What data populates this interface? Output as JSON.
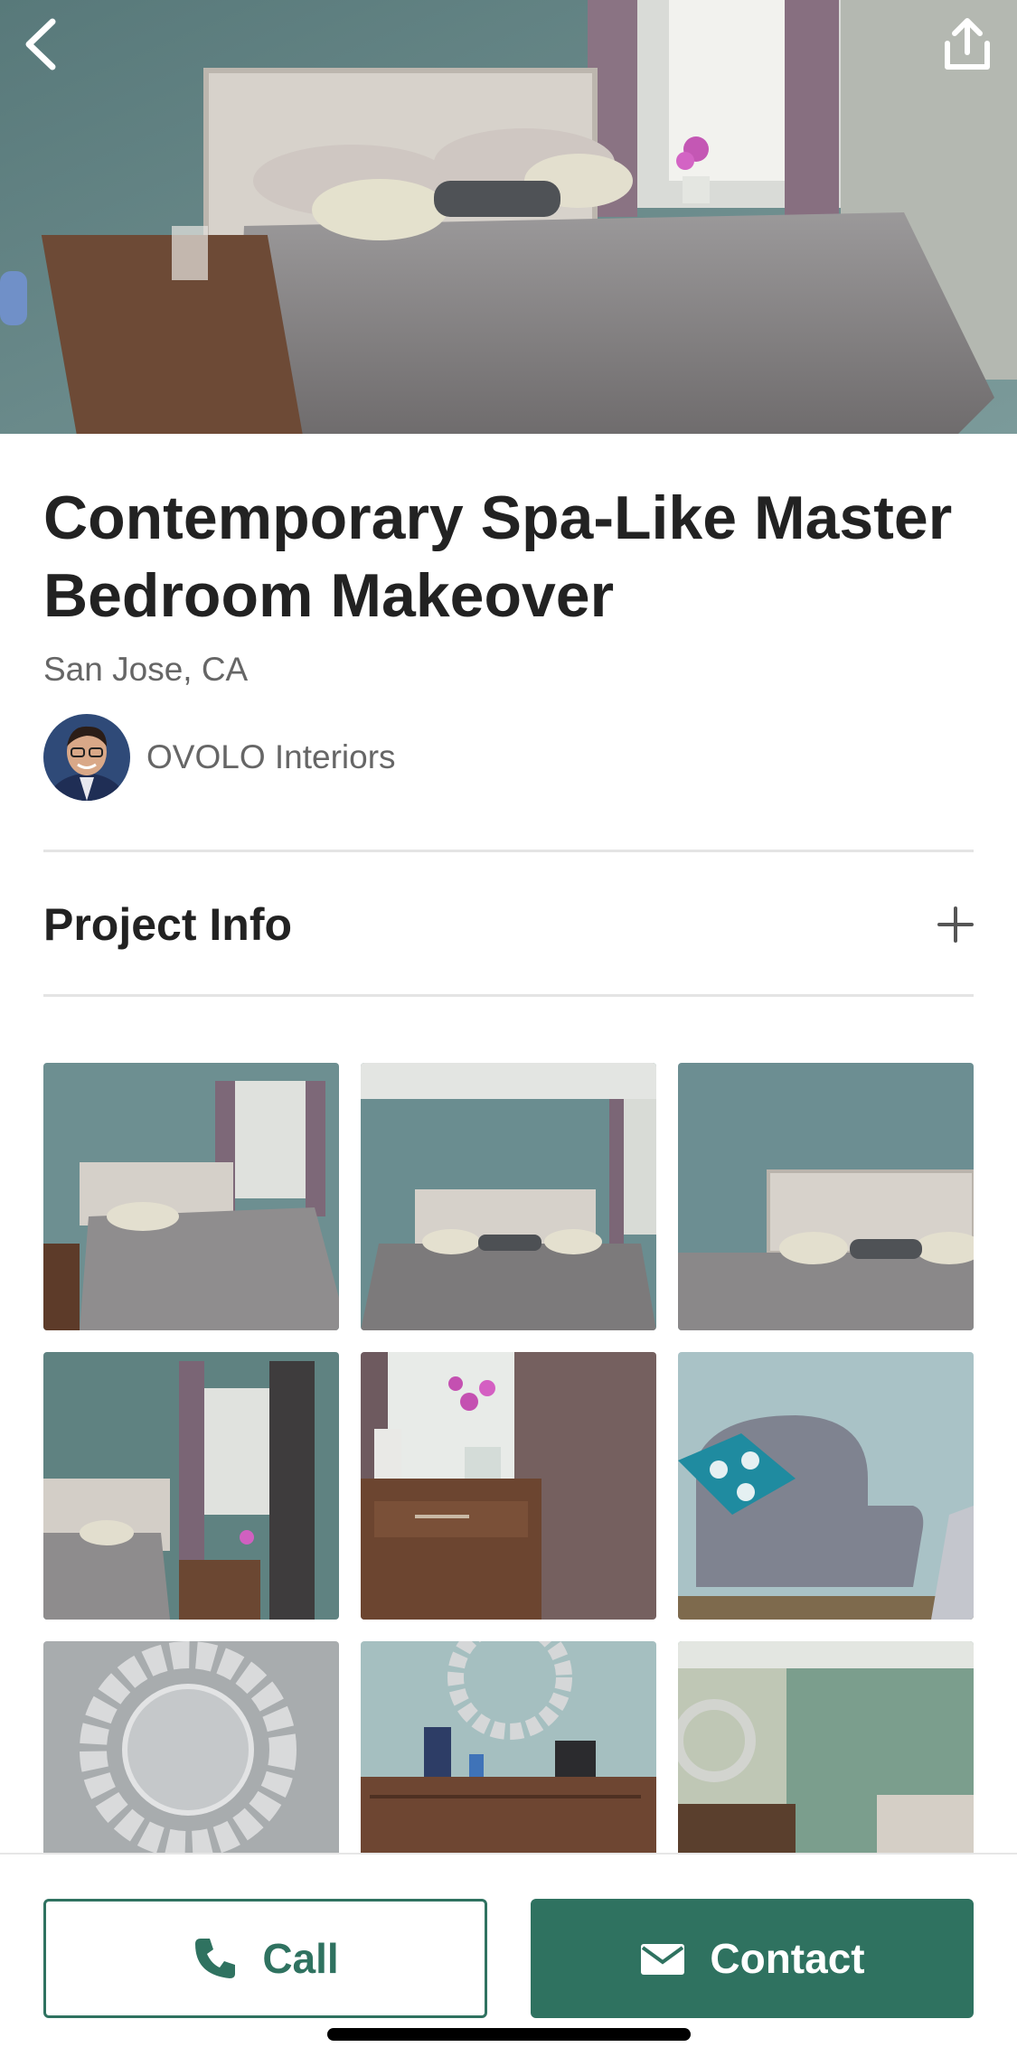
{
  "header": {
    "back_icon": "chevron-left-icon",
    "share_icon": "share-icon"
  },
  "project": {
    "title": "Contemporary Spa-Like Master Bedroom Makeover",
    "location": "San Jose, CA",
    "professional_name": "OVOLO Interiors"
  },
  "project_info": {
    "label": "Project Info",
    "expand_icon": "plus-icon"
  },
  "gallery": {
    "thumbnails": [
      "bedroom-wide-view",
      "bedroom-bed-front",
      "bedroom-headboard-closeup",
      "bedroom-corner-window",
      "nightstand-orchid",
      "armchair-teal-pillow",
      "sunburst-mirror",
      "dresser-mirror",
      "bedroom-dresser-view"
    ]
  },
  "actions": {
    "call_label": "Call",
    "contact_label": "Contact"
  },
  "colors": {
    "accent": "#2f7260",
    "wall": "#6e8f91",
    "bedding": "#8e8b8c"
  }
}
